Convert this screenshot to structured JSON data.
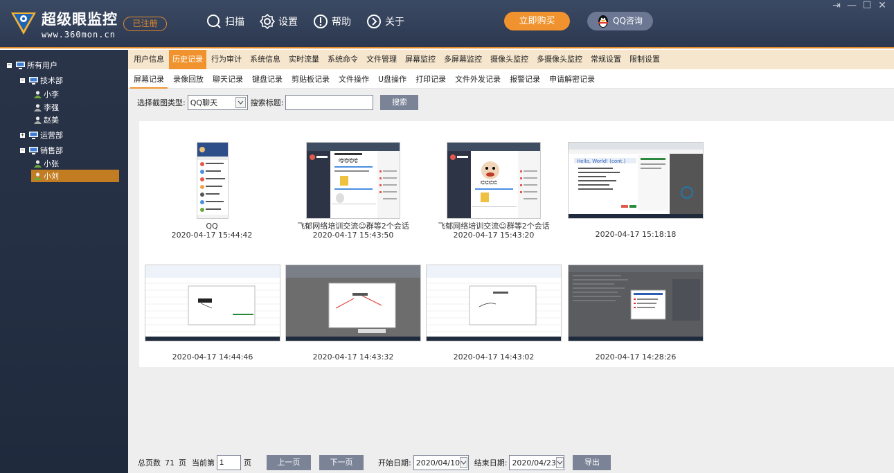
{
  "app": {
    "brand_name": "超级眼监控",
    "brand_url": "www.360mon.cn",
    "registered_badge": "已注册",
    "buy_button": "立即购买",
    "qq_button": "QQ咨询",
    "colors": {
      "titlebar": "#2f3b55",
      "accent": "#f0922d",
      "sidebar": "#243047"
    }
  },
  "topnav": [
    {
      "label": "扫描",
      "icon": "scan-icon"
    },
    {
      "label": "设置",
      "icon": "gear-icon"
    },
    {
      "label": "帮助",
      "icon": "help-icon"
    },
    {
      "label": "关于",
      "icon": "about-icon"
    }
  ],
  "window_controls": [
    "⇥",
    "—",
    "☐",
    "✕"
  ],
  "sidebar": {
    "root": "所有用户",
    "groups": [
      {
        "label": "技术部",
        "toggle": "−",
        "users": [
          "小李",
          "李强",
          "赵美"
        ]
      },
      {
        "label": "运营部",
        "toggle": "+",
        "users": []
      },
      {
        "label": "销售部",
        "toggle": "−",
        "users": [
          "小张",
          "小刘"
        ]
      }
    ],
    "selected_user": "小刘"
  },
  "tabs_primary": [
    "用户信息",
    "历史记录",
    "行为审计",
    "系统信息",
    "实时流量",
    "系统命令",
    "文件管理",
    "屏幕监控",
    "多屏幕监控",
    "摄像头监控",
    "多摄像头监控",
    "常规设置",
    "限制设置"
  ],
  "tabs_primary_active": "历史记录",
  "tabs_secondary": [
    "屏幕记录",
    "录像回放",
    "聊天记录",
    "键盘记录",
    "剪贴板记录",
    "文件操作",
    "U盘操作",
    "打印记录",
    "文件外发记录",
    "报警记录",
    "申请解密记录"
  ],
  "tabs_secondary_active": "屏幕记录",
  "filter": {
    "type_label": "选择截图类型:",
    "type_value": "QQ聊天",
    "title_label": "搜索标题:",
    "title_value": "",
    "search_button": "搜索"
  },
  "screenshots": [
    {
      "title": "QQ",
      "time": "2020-04-17 15:44:42",
      "kind": "phone"
    },
    {
      "title": "飞郁网络培训交流☺群等2个会话",
      "time": "2020-04-17 15:43:50",
      "kind": "qqchat1"
    },
    {
      "title": "飞郁网络培训交流☺群等2个会话",
      "time": "2020-04-17 15:43:20",
      "kind": "qqchat2"
    },
    {
      "title": "",
      "time": "2020-04-17 15:18:18",
      "kind": "browser"
    },
    {
      "title": "",
      "time": "2020-04-17 14:44:46",
      "kind": "sheet"
    },
    {
      "title": "",
      "time": "2020-04-17 14:43:32",
      "kind": "sheetdark"
    },
    {
      "title": "",
      "time": "2020-04-17 14:43:02",
      "kind": "sheet"
    },
    {
      "title": "",
      "time": "2020-04-17 14:28:26",
      "kind": "dialogdark"
    }
  ],
  "pager": {
    "total_label": "总页数",
    "total_pages": "71",
    "page_unit": "页",
    "current_label": "当前第",
    "current_page": "1",
    "current_unit": "页",
    "prev_button": "上一页",
    "next_button": "下一页",
    "start_label": "开始日期:",
    "start_date": "2020/04/10",
    "end_label": "结束日期:",
    "end_date": "2020/04/23",
    "export_button": "导出"
  }
}
